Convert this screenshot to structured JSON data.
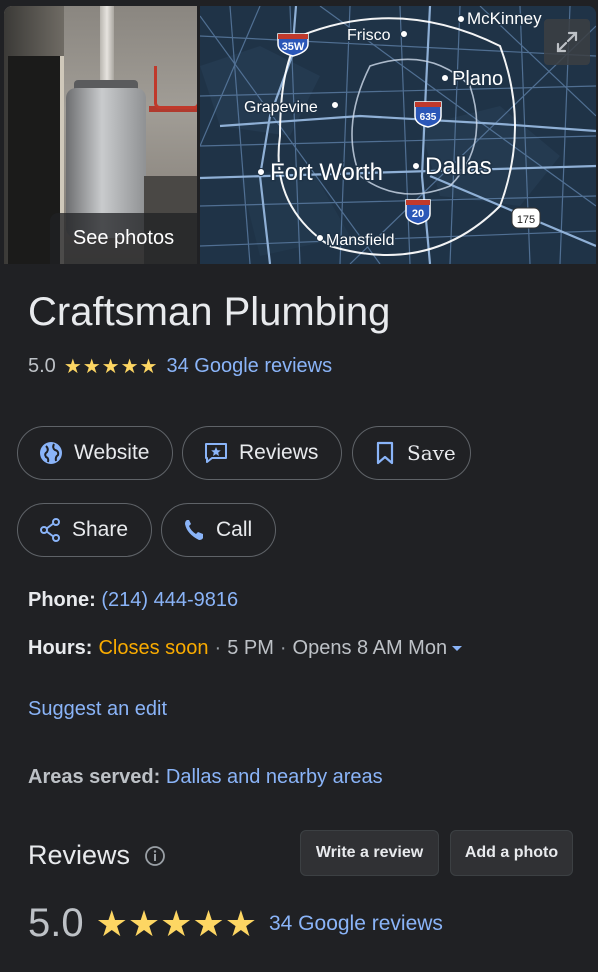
{
  "media": {
    "see_photos_label": "See photos",
    "map_labels": {
      "mckinney": "McKinney",
      "frisco": "Frisco",
      "plano": "Plano",
      "grapevine": "Grapevine",
      "fort_worth": "Fort Worth",
      "dallas": "Dallas",
      "mansfield": "Mansfield"
    },
    "highway_shields": {
      "i35w": "35W",
      "i635": "635",
      "i20": "20",
      "hwy175": "175"
    }
  },
  "business": {
    "name": "Craftsman Plumbing",
    "rating": "5.0",
    "stars": "★★★★★",
    "reviews_link": "34 Google reviews"
  },
  "actions": {
    "website": "Website",
    "reviews": "Reviews",
    "save": "Save",
    "share": "Share",
    "call": "Call"
  },
  "details": {
    "phone_label": "Phone:",
    "phone_value": "(214) 444-9816",
    "hours_label": "Hours:",
    "hours_status": "Closes soon",
    "hours_close": "5 PM",
    "hours_next": "Opens 8 AM Mon",
    "suggest_edit": "Suggest an edit",
    "areas_label": "Areas served:",
    "areas_value": "Dallas and nearby areas"
  },
  "reviews_section": {
    "heading": "Reviews",
    "write_review": "Write a review",
    "add_photo": "Add a photo",
    "rating": "5.0",
    "stars": "★★★★★",
    "reviews_link": "34 Google reviews"
  },
  "colors": {
    "background": "#202124",
    "link": "#8ab4f8",
    "star": "#fdd663",
    "closes_soon": "#f9ab00",
    "map_water": "#1e3146",
    "map_roads": "#6f8fb5"
  }
}
